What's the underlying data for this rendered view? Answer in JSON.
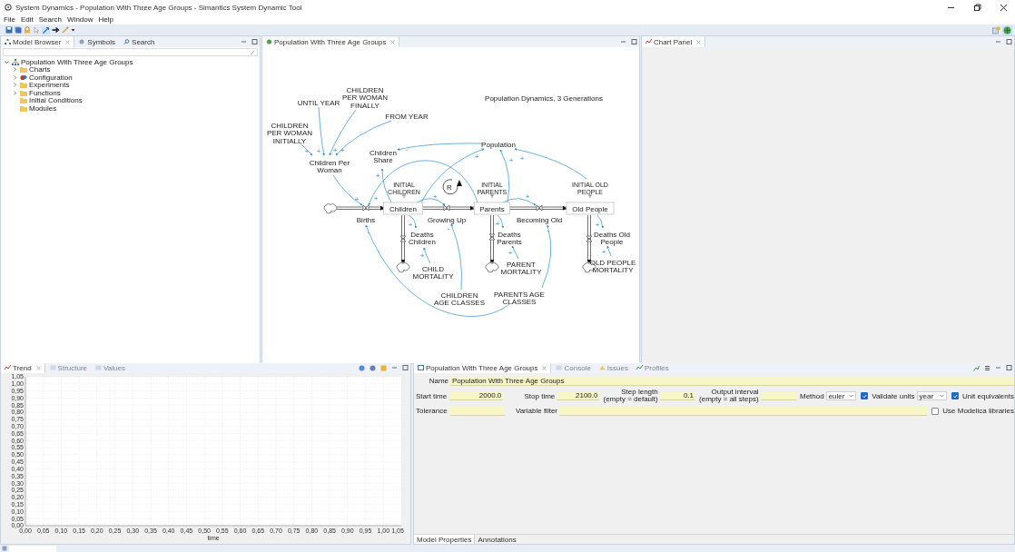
{
  "window": {
    "title": "System Dynamics - Population With Three Age Groups - Simantics System Dynamic Tool"
  },
  "menu": [
    "File",
    "Edit",
    "Search",
    "Window",
    "Help"
  ],
  "model_browser": {
    "tabs": [
      {
        "label": "Model Browser",
        "selected": true
      },
      {
        "label": "Symbols",
        "selected": false
      },
      {
        "label": "Search",
        "selected": false
      }
    ],
    "tree": [
      {
        "label": "Population With Three Age Groups",
        "kind": "model",
        "expandable": true,
        "expanded": true,
        "children": [
          {
            "label": "Charts",
            "kind": "folder",
            "expandable": true,
            "expanded": false
          },
          {
            "label": "Configuration",
            "kind": "config",
            "expandable": true,
            "expanded": false
          },
          {
            "label": "Experiments",
            "kind": "folder",
            "expandable": true,
            "expanded": false
          },
          {
            "label": "Functions",
            "kind": "folder",
            "expandable": true,
            "expanded": false
          },
          {
            "label": "Initial Conditions",
            "kind": "folder",
            "expandable": false,
            "expanded": false
          },
          {
            "label": "Modules",
            "kind": "folder",
            "expandable": false,
            "expanded": false
          }
        ]
      }
    ]
  },
  "diagram": {
    "tab": "Population With Three Age Groups",
    "note": "Population Dynamics, 3 Generations",
    "loop": "R",
    "nodes": [
      {
        "kind": "aux",
        "lines": [
          "CHILDREN",
          "PER WOMAN",
          "INITIALLY"
        ]
      },
      {
        "kind": "aux",
        "lines": [
          "UNTIL YEAR"
        ]
      },
      {
        "kind": "aux",
        "lines": [
          "CHILDREN",
          "PER WOMAN",
          "FINALLY"
        ]
      },
      {
        "kind": "aux",
        "lines": [
          "FROM YEAR"
        ]
      },
      {
        "kind": "aux",
        "lines": [
          "Children Per",
          "Woman"
        ]
      },
      {
        "kind": "aux",
        "lines": [
          "Population"
        ]
      },
      {
        "kind": "aux",
        "lines": [
          "Children",
          "Share"
        ]
      },
      {
        "kind": "initial",
        "lines": [
          "INITIAL",
          "CHILDREN"
        ]
      },
      {
        "kind": "stock",
        "lines": [
          "Children"
        ]
      },
      {
        "kind": "flow",
        "lines": [
          "Births"
        ]
      },
      {
        "kind": "flow",
        "lines": [
          "Growing Up"
        ]
      },
      {
        "kind": "initial",
        "lines": [
          "INITIAL",
          "PARENTS"
        ]
      },
      {
        "kind": "stock",
        "lines": [
          "Parents"
        ]
      },
      {
        "kind": "flow",
        "lines": [
          "Becoming Old"
        ]
      },
      {
        "kind": "initial",
        "lines": [
          "INITIAL OLD",
          "PEOPLE"
        ]
      },
      {
        "kind": "stock",
        "lines": [
          "Old People"
        ]
      },
      {
        "kind": "flow",
        "lines": [
          "Deaths",
          "Children"
        ]
      },
      {
        "kind": "flow",
        "lines": [
          "Deaths",
          "Parents"
        ]
      },
      {
        "kind": "flow",
        "lines": [
          "Deaths Old",
          "People"
        ]
      },
      {
        "kind": "aux",
        "lines": [
          "CHILD",
          "MORTALITY"
        ]
      },
      {
        "kind": "aux",
        "lines": [
          "PARENT",
          "MORTALITY"
        ]
      },
      {
        "kind": "aux",
        "lines": [
          "OLD PEOPLE",
          "MORTALITY"
        ]
      },
      {
        "kind": "aux",
        "lines": [
          "CHILDREN",
          "AGE CLASSES"
        ]
      },
      {
        "kind": "aux",
        "lines": [
          "PARENTS AGE",
          "CLASSES"
        ]
      }
    ],
    "links": [
      {
        "polarity": "+"
      },
      {
        "polarity": "+"
      },
      {
        "polarity": "+"
      },
      {
        "polarity": "+"
      },
      {
        "polarity": "+"
      },
      {
        "polarity": "-"
      },
      {
        "polarity": "+"
      },
      {
        "polarity": "+"
      },
      {
        "polarity": "+"
      },
      {
        "polarity": "+"
      },
      {
        "polarity": "+"
      },
      {
        "polarity": "+"
      },
      {
        "polarity": "+"
      },
      {
        "polarity": "+"
      },
      {
        "polarity": "+"
      },
      {
        "polarity": "+"
      },
      {
        "polarity": "+"
      },
      {
        "polarity": "+"
      },
      {
        "polarity": "+"
      },
      {
        "polarity": "-"
      },
      {
        "polarity": "-"
      },
      {
        "polarity": "-"
      }
    ]
  },
  "chart_panel": {
    "tab": "Chart Panel"
  },
  "trend": {
    "tabs": [
      {
        "label": "Trend",
        "selected": true
      },
      {
        "label": "Structure",
        "selected": false
      },
      {
        "label": "Values",
        "selected": false
      }
    ],
    "chart_data": {
      "type": "line",
      "grid": true,
      "xlabel": "time",
      "xlim": [
        0,
        1.05
      ],
      "ylim": [
        0,
        1.05
      ],
      "xticks": [
        {
          "value": 0,
          "label": "0,00"
        },
        {
          "value": 0.05,
          "label": "0,05"
        },
        {
          "value": 0.1,
          "label": "0,10"
        },
        {
          "value": 0.15,
          "label": "0,15"
        },
        {
          "value": 0.2,
          "label": "0,20"
        },
        {
          "value": 0.25,
          "label": "0,25"
        },
        {
          "value": 0.3,
          "label": "0,30"
        },
        {
          "value": 0.35,
          "label": "0,35"
        },
        {
          "value": 0.4,
          "label": "0,40"
        },
        {
          "value": 0.45,
          "label": "0,45"
        },
        {
          "value": 0.5,
          "label": "0,50"
        },
        {
          "value": 0.55,
          "label": "0,55"
        },
        {
          "value": 0.6,
          "label": "0,60"
        },
        {
          "value": 0.65,
          "label": "0,65"
        },
        {
          "value": 0.7,
          "label": "0,70"
        },
        {
          "value": 0.75,
          "label": "0,75"
        },
        {
          "value": 0.8,
          "label": "0,80"
        },
        {
          "value": 0.85,
          "label": "0,85"
        },
        {
          "value": 0.9,
          "label": "0,90"
        },
        {
          "value": 0.95,
          "label": "0,95"
        },
        {
          "value": 1,
          "label": "1,00"
        },
        {
          "value": 1.05,
          "label": "1,05"
        }
      ],
      "yticks": [
        {
          "value": 0,
          "label": "0,00"
        },
        {
          "value": 0.05,
          "label": "0,05"
        },
        {
          "value": 0.1,
          "label": "0,10"
        },
        {
          "value": 0.15,
          "label": "0,15"
        },
        {
          "value": 0.2,
          "label": "0,20"
        },
        {
          "value": 0.25,
          "label": "0,25"
        },
        {
          "value": 0.3,
          "label": "0,30"
        },
        {
          "value": 0.35,
          "label": "0,35"
        },
        {
          "value": 0.4,
          "label": "0,40"
        },
        {
          "value": 0.45,
          "label": "0,45"
        },
        {
          "value": 0.5,
          "label": "0,50"
        },
        {
          "value": 0.55,
          "label": "0,55"
        },
        {
          "value": 0.6,
          "label": "0,60"
        },
        {
          "value": 0.65,
          "label": "0,65"
        },
        {
          "value": 0.7,
          "label": "0,70"
        },
        {
          "value": 0.75,
          "label": "0,75"
        },
        {
          "value": 0.8,
          "label": "0,80"
        },
        {
          "value": 0.85,
          "label": "0,85"
        },
        {
          "value": 0.9,
          "label": "0,90"
        },
        {
          "value": 0.95,
          "label": "0,95"
        },
        {
          "value": 1,
          "label": "1,00"
        },
        {
          "value": 1.05,
          "label": "1,05"
        }
      ]
    }
  },
  "properties": {
    "tabs": [
      {
        "label": "Population With Three Age Groups",
        "selected": true
      },
      {
        "label": "Console",
        "selected": false
      },
      {
        "label": "Issues",
        "selected": false
      },
      {
        "label": "Profiles",
        "selected": false
      }
    ],
    "name": {
      "label": "Name",
      "value": "Population With Three Age Groups"
    },
    "start_time": {
      "label": "Start time",
      "value": "2000.0"
    },
    "stop_time": {
      "label": "Stop time",
      "value": "2100.0"
    },
    "step_length": {
      "label": "Step length",
      "hint": "(empty = default)",
      "value": "0.1"
    },
    "output_interval": {
      "label": "Output interval",
      "hint": "(empty = all steps)"
    },
    "method": {
      "label": "Method",
      "value": "euler"
    },
    "validate_units": {
      "label": "Validate units",
      "checked": true
    },
    "unit": {
      "value": "year"
    },
    "unit_equivalents": {
      "label": "Unit equivalents",
      "checked": true
    },
    "tolerance": {
      "label": "Tolerance"
    },
    "variable_filter": {
      "label": "Variable filter"
    },
    "use_modelica": {
      "label": "Use Modelica libraries",
      "checked": false
    },
    "subtabs": [
      {
        "label": "Model Properties",
        "selected": true
      },
      {
        "label": "Annotations",
        "selected": false
      }
    ]
  }
}
